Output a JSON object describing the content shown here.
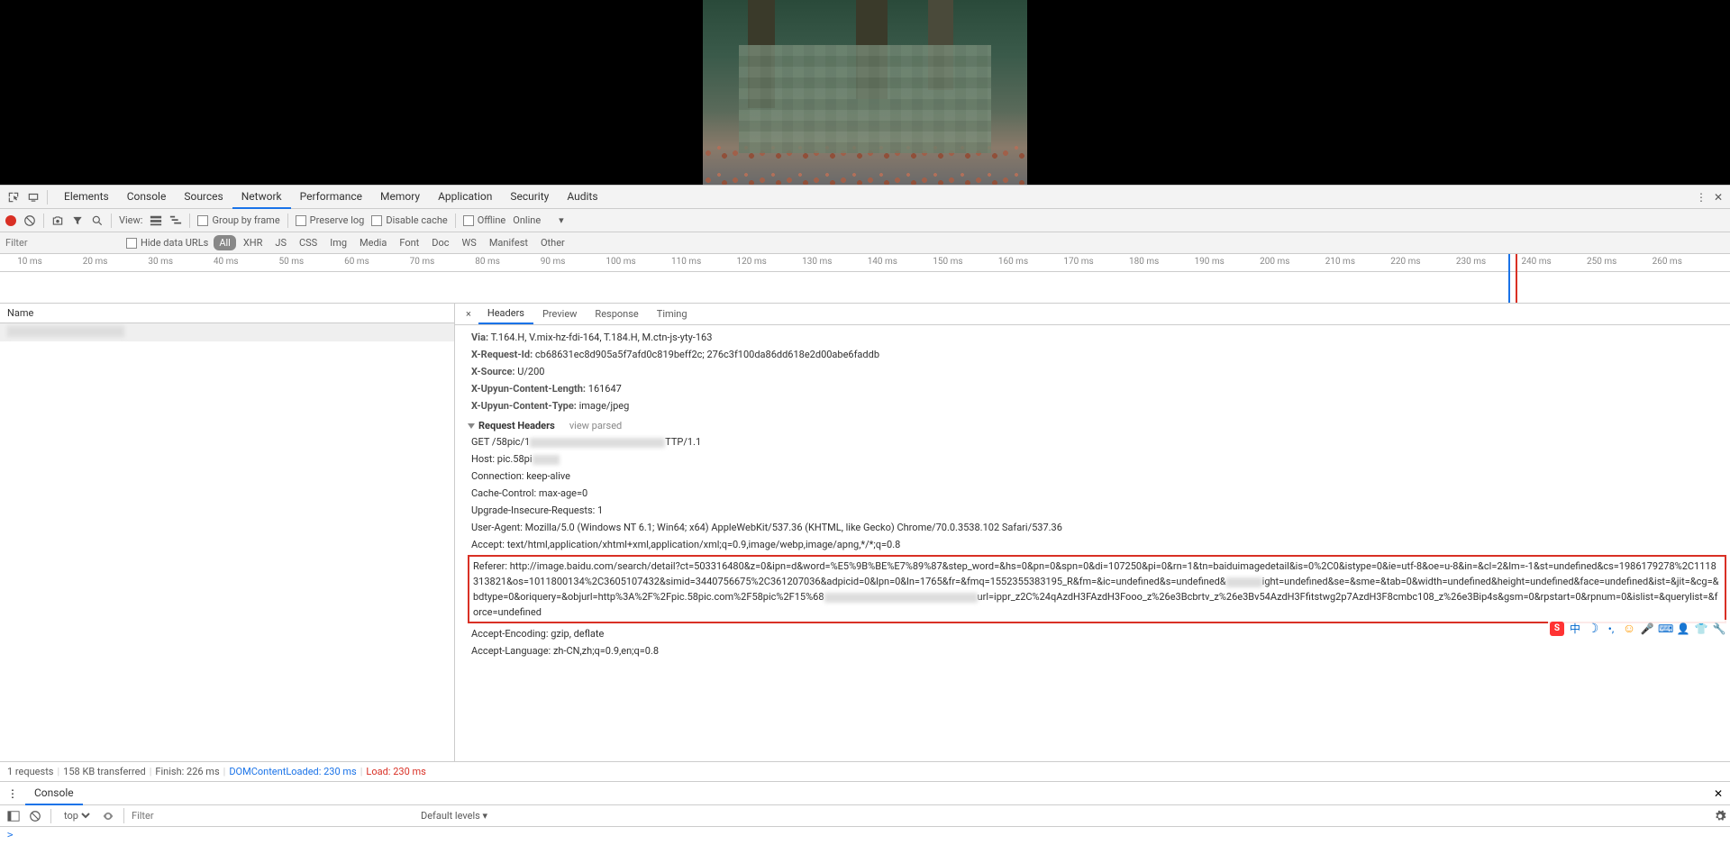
{
  "devtools": {
    "tabs": [
      "Elements",
      "Console",
      "Sources",
      "Network",
      "Performance",
      "Memory",
      "Application",
      "Security",
      "Audits"
    ],
    "active_tab": "Network"
  },
  "toolbar": {
    "view_label": "View:",
    "group_by_frame": "Group by frame",
    "preserve_log": "Preserve log",
    "disable_cache": "Disable cache",
    "offline": "Offline",
    "online": "Online"
  },
  "filter": {
    "placeholder": "Filter",
    "hide_data_urls": "Hide data URLs",
    "types": [
      "All",
      "XHR",
      "JS",
      "CSS",
      "Img",
      "Media",
      "Font",
      "Doc",
      "WS",
      "Manifest",
      "Other"
    ],
    "active_type": "All"
  },
  "timeline": {
    "ticks": [
      "10 ms",
      "20 ms",
      "30 ms",
      "40 ms",
      "50 ms",
      "60 ms",
      "70 ms",
      "80 ms",
      "90 ms",
      "100 ms",
      "110 ms",
      "120 ms",
      "130 ms",
      "140 ms",
      "150 ms",
      "160 ms",
      "170 ms",
      "180 ms",
      "190 ms",
      "200 ms",
      "210 ms",
      "220 ms",
      "230 ms",
      "240 ms",
      "250 ms",
      "260 ms"
    ],
    "marker_pos_pct": 87.4
  },
  "request_list": {
    "header": "Name"
  },
  "details": {
    "tabs": [
      "Headers",
      "Preview",
      "Response",
      "Timing"
    ],
    "active_tab": "Headers",
    "response_headers": {
      "via": {
        "name": "Via:",
        "value": "T.164.H, V.mix-hz-fdi-164, T.184.H, M.ctn-js-yty-163"
      },
      "x_request_id": {
        "name": "X-Request-Id:",
        "value": "cb68631ec8d905a5f7afd0c819beff2c; 276c3f100da86dd618e2d00abe6faddb"
      },
      "x_source": {
        "name": "X-Source:",
        "value": "U/200"
      },
      "x_upyun_content_length": {
        "name": "X-Upyun-Content-Length:",
        "value": "161647"
      },
      "x_upyun_content_type": {
        "name": "X-Upyun-Content-Type:",
        "value": "image/jpeg"
      }
    },
    "request_headers_title": "Request Headers",
    "view_parsed": "view parsed",
    "request_headers": {
      "get_prefix": "GET /58pic/1",
      "get_suffix": "TTP/1.1",
      "host_prefix": "Host: pic.58pi",
      "connection": "Connection: keep-alive",
      "cache_control": "Cache-Control: max-age=0",
      "upgrade": "Upgrade-Insecure-Requests: 1",
      "user_agent": "User-Agent: Mozilla/5.0 (Windows NT 6.1; Win64; x64) AppleWebKit/537.36 (KHTML, like Gecko) Chrome/70.0.3538.102 Safari/537.36",
      "accept": "Accept: text/html,application/xhtml+xml,application/xml;q=0.9,image/webp,image/apng,*/*;q=0.8",
      "referer_line1": "Referer: http://image.baidu.com/search/detail?ct=503316480&z=0&ipn=d&word=%E5%9B%BE%E7%89%87&step_word=&hs=0&pn=0&spn=0&di=107250&pi=0&rn=1&tn=baiduimagedetail&is=0%2C0&istype=0&ie=utf-8&oe=u",
      "referer_line2_prefix": "-8&in=&cl=2&lm=-1&st=undefined&cs=1986179278%2C1118313821&os=1011800134%2C3605107432&simid=3440756675%2C361207036&adpicid=0&lpn=0&ln=1765&fr=&fmq=1552355383195_R&fm=&ic=undefined&s=undefined&",
      "referer_line2_mid": "ight=undefined&se=&sme=&tab=0&width=undefined&height=undefined&face=undefined&ist=&jit=&cg=&bdtype=0&oriquery=&objurl=http%3A%2F%2Fpic.58pic.com%2F58pic%2F15%",
      "referer_line3_prefix": "68",
      "referer_line3_suffix": "url=ippr_z2C%24qAzdH3FAzdH3Fooo_z%26e3Bcbrtv_z%26e3Bv54AzdH3Ffitstwg2p7AzdH3F8cmbc108_z%26e3Bip4s&gsm=0&rpstart=0&rpnum=0&islist=&querylist=&force=undefined",
      "accept_encoding": "Accept-Encoding: gzip, deflate",
      "accept_language": "Accept-Language: zh-CN,zh;q=0.9,en;q=0.8"
    }
  },
  "status": {
    "requests": "1 requests",
    "transferred": "158 KB transferred",
    "finish": "Finish: 226 ms",
    "dom_loaded": "DOMContentLoaded: 230 ms",
    "load": "Load: 230 ms"
  },
  "console": {
    "tab": "Console",
    "context": "top",
    "filter_placeholder": "Filter",
    "levels": "Default levels",
    "prompt": ">"
  }
}
